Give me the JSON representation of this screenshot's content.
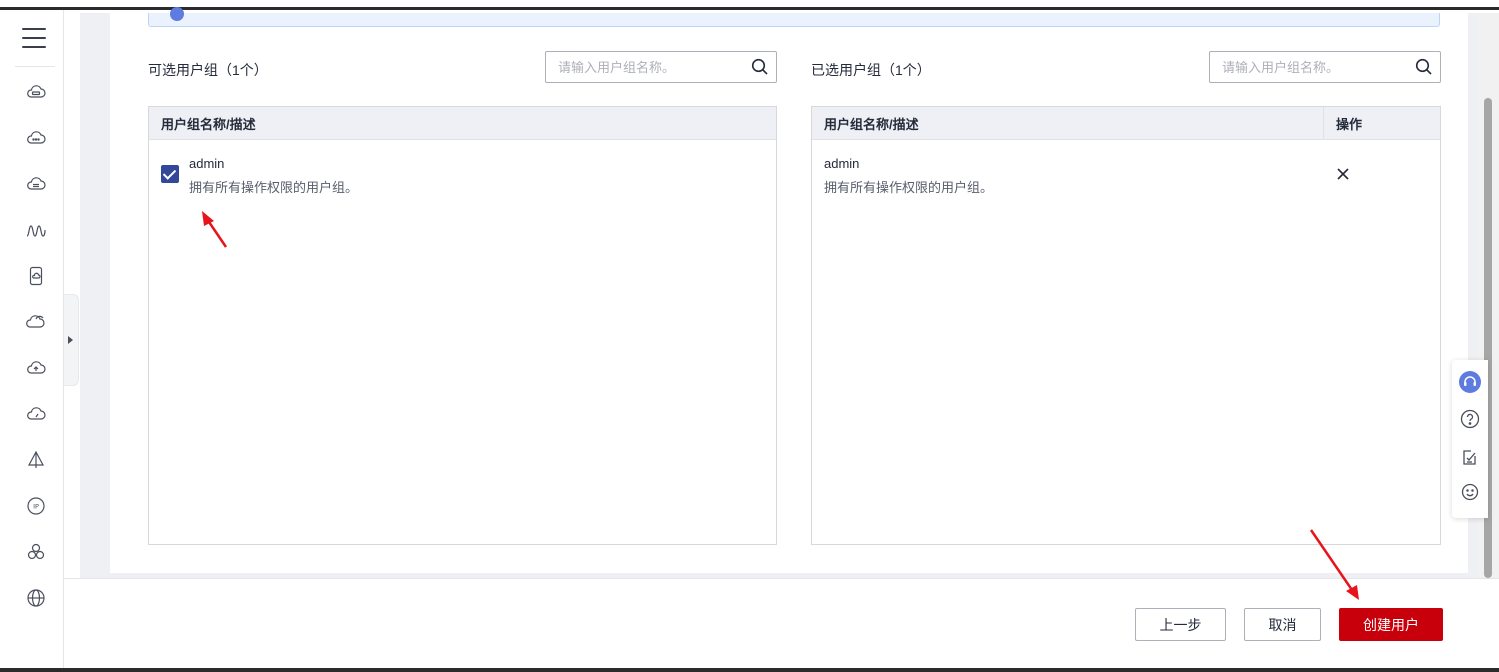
{
  "sidebar": {
    "menu_icon": "hamburger-menu-icon",
    "icons": [
      "cloud-server-icon",
      "cloud-more-icon",
      "cloud-storage-icon",
      "monitoring-wave-icon",
      "mobile-device-icon",
      "cloud-service-icon",
      "cloud-upload-icon",
      "cloud-speed-icon",
      "network-triangle-icon",
      "ip-address-icon",
      "cluster-icon",
      "global-network-icon"
    ]
  },
  "available_panel": {
    "title": "可选用户组（1个）",
    "search_placeholder": "请输入用户组名称。",
    "column_header": "用户组名称/描述",
    "rows": [
      {
        "name": "admin",
        "description": "拥有所有操作权限的用户组。",
        "checked": true
      }
    ]
  },
  "selected_panel": {
    "title": "已选用户组（1个）",
    "search_placeholder": "请输入用户组名称。",
    "column_header_name": "用户组名称/描述",
    "column_header_action": "操作",
    "rows": [
      {
        "name": "admin",
        "description": "拥有所有操作权限的用户组。"
      }
    ]
  },
  "footer": {
    "prev_label": "上一步",
    "cancel_label": "取消",
    "create_label": "创建用户"
  },
  "float_bar": {
    "icons": [
      "customer-service-icon",
      "help-icon",
      "feedback-edit-icon",
      "satisfaction-smiley-icon"
    ]
  },
  "colors": {
    "primary": "#c7000b",
    "checkbox": "#344899",
    "annotation_arrow": "#e8141b",
    "header_bg": "#eef0f5"
  }
}
